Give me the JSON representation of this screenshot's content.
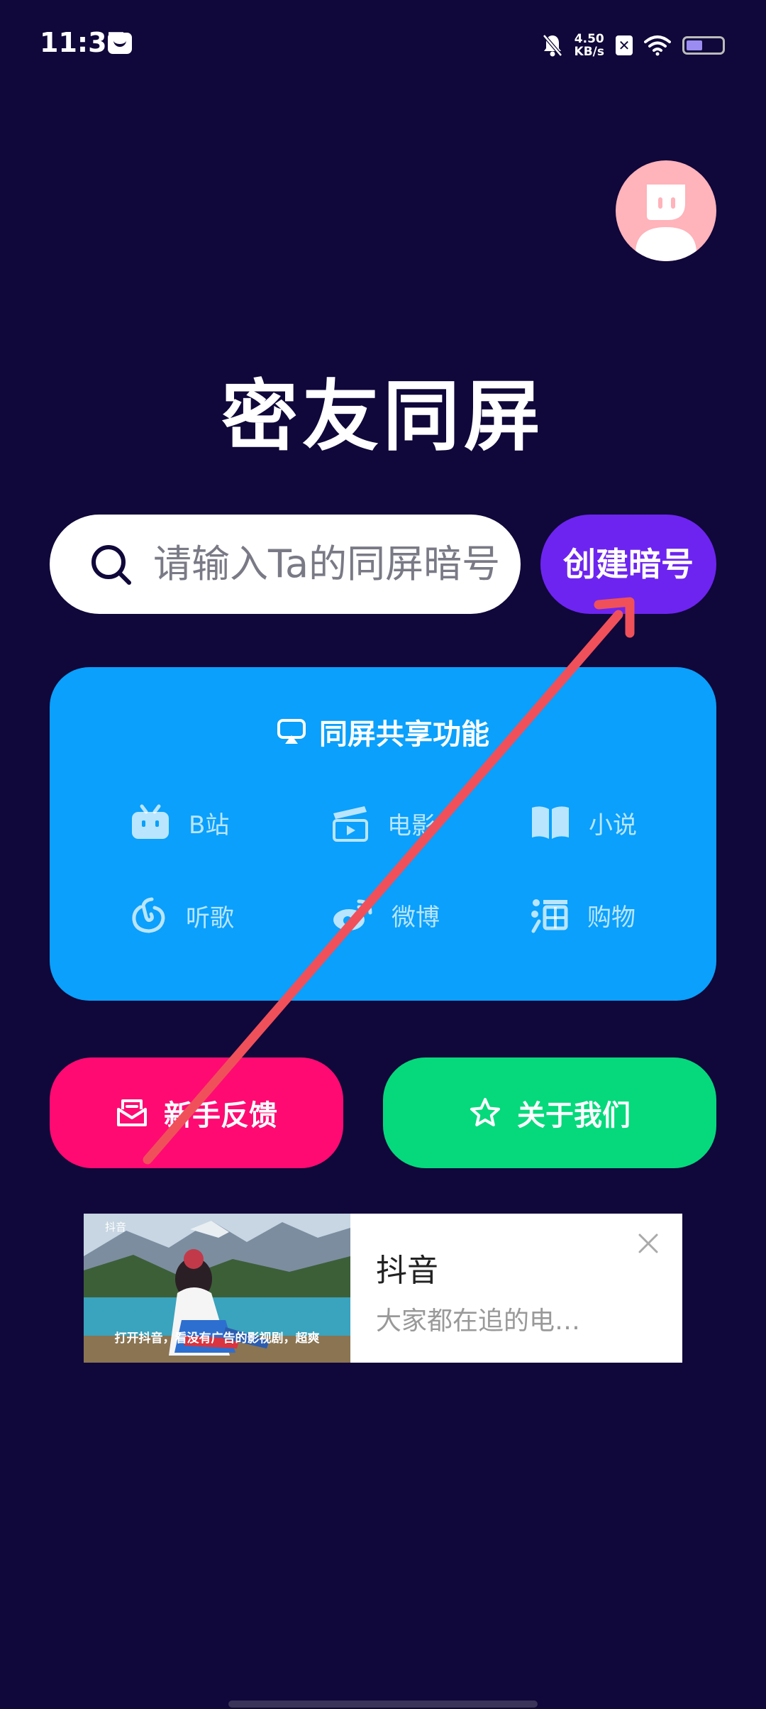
{
  "status_bar": {
    "time": "11:37",
    "net_speed_value": "4.50",
    "net_speed_unit": "KB/s",
    "battery_level": 0.45
  },
  "header": {
    "app_title": "密友同屏"
  },
  "search": {
    "placeholder": "请输入Ta的同屏暗号"
  },
  "create_button": {
    "label": "创建暗号"
  },
  "features": {
    "title": "同屏共享功能",
    "items": [
      {
        "label": "B站",
        "icon": "bilibili-icon"
      },
      {
        "label": "电影",
        "icon": "movie-clapper-icon"
      },
      {
        "label": "小说",
        "icon": "book-icon"
      },
      {
        "label": "听歌",
        "icon": "netease-music-icon"
      },
      {
        "label": "微博",
        "icon": "weibo-icon"
      },
      {
        "label": "购物",
        "icon": "taobao-icon"
      }
    ]
  },
  "actions": {
    "feedback_label": "新手反馈",
    "about_label": "关于我们"
  },
  "ad": {
    "logo_text": "抖音",
    "caption": "打开抖音，看没有广告的影视剧，超爽",
    "title": "抖音",
    "description": "大家都在追的电…"
  },
  "colors": {
    "background": "#10073a",
    "create_button": "#6d24f0",
    "feature_card": "#0aa0fb",
    "feedback_button": "#ff0a72",
    "about_button": "#05d97c",
    "annotation_arrow": "#f0505a"
  }
}
